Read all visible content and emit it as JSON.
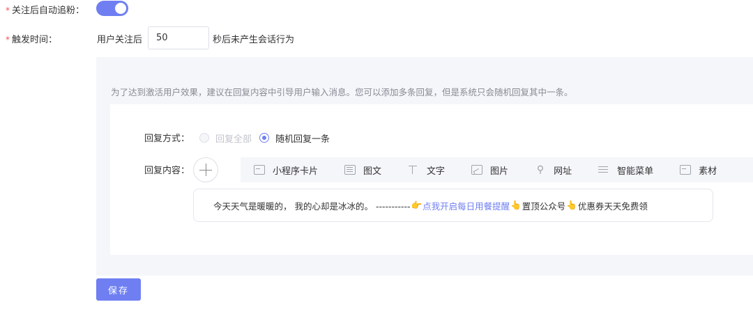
{
  "auto_follow": {
    "label": "关注后自动追粉：",
    "enabled": true
  },
  "trigger": {
    "label": "触发时间：",
    "prefix": "用户关注后",
    "seconds": "50",
    "suffix": "秒后未产生会话行为"
  },
  "hint": "为了达到激活用户效果，建议在回复内容中引导用户输入消息。您可以添加多条回复，但是系统只会随机回复其中一条。",
  "reply_mode": {
    "label": "回复方式：",
    "options": [
      {
        "label": "回复全部",
        "checked": false,
        "disabled": true
      },
      {
        "label": "随机回复一条",
        "checked": true,
        "disabled": false
      }
    ]
  },
  "reply_content": {
    "label": "回复内容：",
    "tools": [
      {
        "label": "小程序卡片",
        "icon": "mini-program-card-icon"
      },
      {
        "label": "图文",
        "icon": "news-icon"
      },
      {
        "label": "文字",
        "icon": "text-icon"
      },
      {
        "label": "图片",
        "icon": "image-icon"
      },
      {
        "label": "网址",
        "icon": "link-icon"
      },
      {
        "label": "智能菜单",
        "icon": "menu-icon"
      },
      {
        "label": "素材",
        "icon": "material-icon"
      }
    ],
    "message": {
      "text_before": "今天天气是暖暖的， 我的心却是冰冰的。 -----------",
      "emoji_point_right": "👉",
      "link_text": "点我开启每日用餐提醒",
      "emoji_point_up_1": "👆",
      "text_mid": "置顶公众号",
      "emoji_point_up_2": "👆",
      "text_after": " 优惠券天天免费领"
    }
  },
  "save_label": "保存",
  "colors": {
    "accent": "#6f7ff2",
    "required": "#f5504e",
    "panel_bg": "#f5f6fa"
  }
}
